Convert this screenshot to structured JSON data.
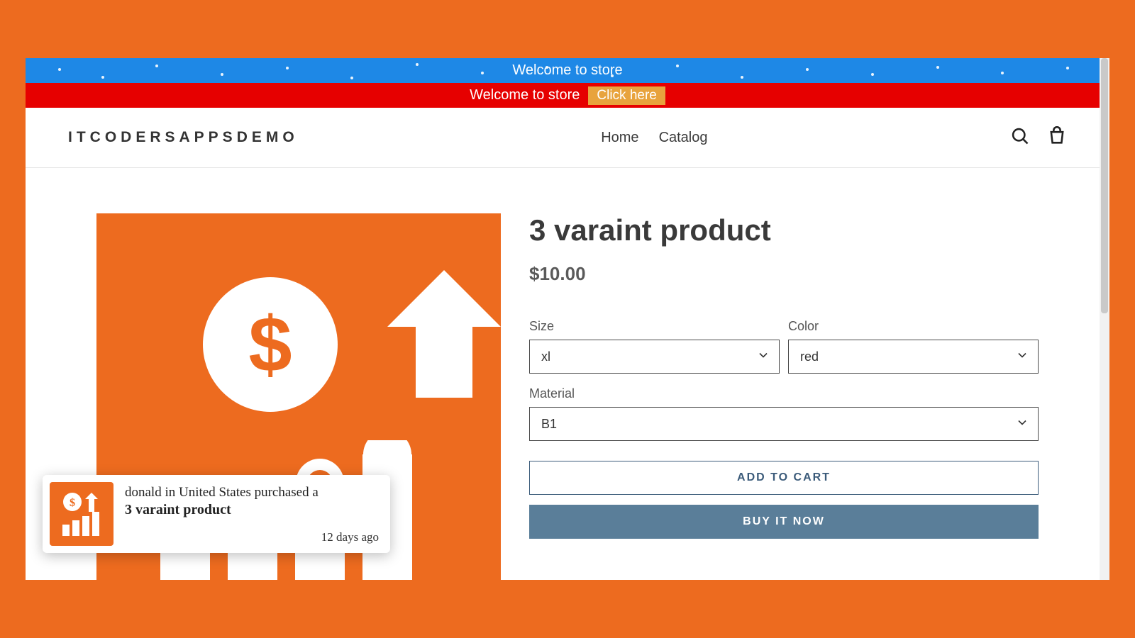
{
  "banner_blue": {
    "text": "Welcome to store"
  },
  "banner_red": {
    "text": "Welcome to store",
    "cta": "Click here"
  },
  "header": {
    "logo": "ITCODERSAPPSDEMO",
    "nav": [
      "Home",
      "Catalog"
    ]
  },
  "product": {
    "title": "3 varaint product",
    "price": "$10.00",
    "variants": {
      "size": {
        "label": "Size",
        "selected": "xl"
      },
      "color": {
        "label": "Color",
        "selected": "red"
      },
      "material": {
        "label": "Material",
        "selected": "B1"
      }
    },
    "add_to_cart": "ADD TO CART",
    "buy_now": "BUY IT NOW"
  },
  "notification": {
    "line1": "donald in United States purchased a",
    "line2": "3 varaint product",
    "time": "12 days ago"
  }
}
